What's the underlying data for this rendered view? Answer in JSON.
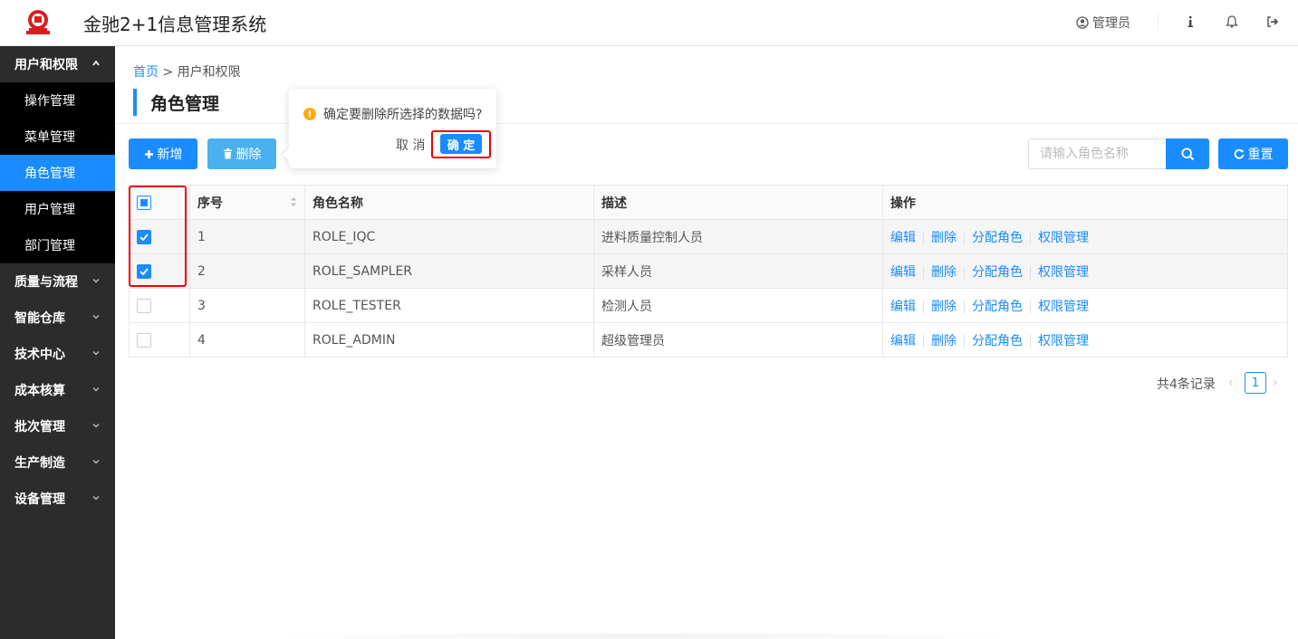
{
  "header": {
    "app_title": "金驰2+1信息管理系统",
    "user_label": "管理员"
  },
  "sidebar": {
    "groups": [
      {
        "label": "用户和权限",
        "expanded": true,
        "items": [
          {
            "label": "操作管理",
            "active": false
          },
          {
            "label": "菜单管理",
            "active": false
          },
          {
            "label": "角色管理",
            "active": true
          },
          {
            "label": "用户管理",
            "active": false
          },
          {
            "label": "部门管理",
            "active": false
          }
        ]
      },
      {
        "label": "质量与流程",
        "expanded": false
      },
      {
        "label": "智能仓库",
        "expanded": false
      },
      {
        "label": "技术中心",
        "expanded": false
      },
      {
        "label": "成本核算",
        "expanded": false
      },
      {
        "label": "批次管理",
        "expanded": false
      },
      {
        "label": "生产制造",
        "expanded": false
      },
      {
        "label": "设备管理",
        "expanded": false
      }
    ]
  },
  "breadcrumb": {
    "home": "首页",
    "separator": ">",
    "current": "用户和权限"
  },
  "page_title": "角色管理",
  "toolbar": {
    "add_label": "新增",
    "delete_label": "删除",
    "reset_label": "重置",
    "search_placeholder": "请输入角色名称"
  },
  "popconfirm": {
    "message": "确定要删除所选择的数据吗?",
    "cancel_label": "取 消",
    "ok_label": "确 定"
  },
  "table": {
    "headers": {
      "no": "序号",
      "name": "角色名称",
      "desc": "描述",
      "ops": "操作"
    },
    "ops": {
      "edit": "编辑",
      "delete": "删除",
      "assign": "分配角色",
      "perm": "权限管理"
    },
    "rows": [
      {
        "no": "1",
        "name": "ROLE_IQC",
        "desc": "进料质量控制人员",
        "checked": true
      },
      {
        "no": "2",
        "name": "ROLE_SAMPLER",
        "desc": "采样人员",
        "checked": true
      },
      {
        "no": "3",
        "name": "ROLE_TESTER",
        "desc": "检测人员",
        "checked": false
      },
      {
        "no": "4",
        "name": "ROLE_ADMIN",
        "desc": "超级管理员",
        "checked": false
      }
    ]
  },
  "pagination": {
    "total_text": "共4条记录",
    "current_page": "1"
  },
  "colors": {
    "primary": "#1a8cff",
    "sidebar_bg": "#2c2c2c",
    "highlight_frame": "#e00000",
    "warning": "#faad14"
  }
}
